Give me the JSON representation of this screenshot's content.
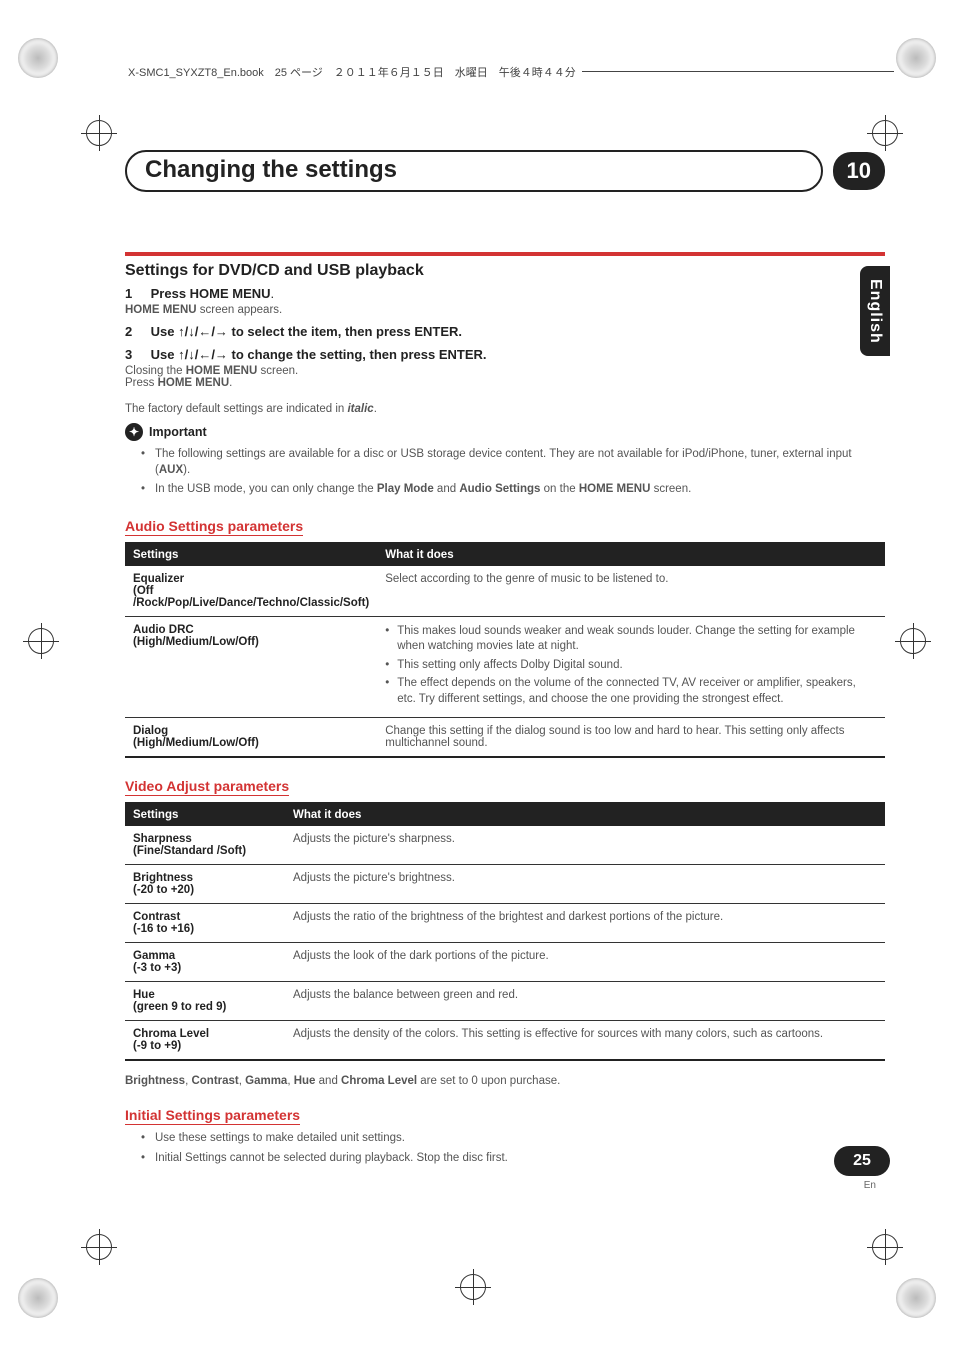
{
  "header_filename": "X-SMC1_SYXZT8_En.book　25 ページ　２０１１年６月１５日　水曜日　午後４時４４分",
  "chapter_title": "Changing the settings",
  "chapter_number": "10",
  "lang_tab": "English",
  "section_title": "Settings for DVD/CD and USB playback",
  "steps": [
    {
      "num": "1",
      "bold": "Press HOME MENU",
      "tail": ".",
      "subtext_prefix": "HOME MENU",
      "subtext_rest": " screen appears."
    },
    {
      "num": "2",
      "bold_prefix": "Use ",
      "arrows": "↑/↓/←/→",
      "bold_suffix": " to select the item, then press ENTER."
    },
    {
      "num": "3",
      "bold_prefix": "Use ",
      "arrows": "↑/↓/←/→",
      "bold_suffix": " to change the setting, then press ENTER.",
      "sub_multi": [
        "Closing the ",
        "HOME MENU",
        " screen.",
        "Press ",
        "HOME MENU",
        "."
      ]
    }
  ],
  "factory_note_pre": "The factory default settings are indicated in ",
  "factory_note_ital": "italic",
  "factory_note_post": ".",
  "important_label": "Important",
  "important_bullets": [
    {
      "parts": [
        "The following settings are available for a disc or USB storage device content. They are not available for iPod/iPhone, tuner, external input (",
        "AUX",
        ")."
      ]
    },
    {
      "parts": [
        "In the USB mode, you can only change the ",
        "Play Mode",
        " and ",
        "Audio Settings",
        " on the ",
        "HOME MENU",
        " screen."
      ]
    }
  ],
  "audio_heading": "Audio Settings parameters",
  "table_headers": {
    "col1": "Settings",
    "col2": "What it does"
  },
  "audio_rows": [
    {
      "name": "Equalizer",
      "sub": "(Off /Rock/Pop/Live/Dance/Techno/Classic/Soft)",
      "desc_plain": "Select according to the genre of music to be listened to."
    },
    {
      "name": "Audio DRC",
      "sub": "(High/Medium/Low/Off)",
      "desc_list": [
        "This makes loud sounds weaker and weak sounds louder. Change the setting for example when watching movies late at night.",
        "This setting only affects Dolby Digital sound.",
        "The effect depends on the volume of the connected TV, AV receiver or amplifier, speakers, etc. Try different settings, and choose the one providing the strongest effect."
      ]
    },
    {
      "name": "Dialog",
      "sub": "(High/Medium/Low/Off)",
      "desc_plain": "Change this setting if the dialog sound is too low and hard to hear. This setting only affects multichannel sound."
    }
  ],
  "video_heading": "Video Adjust parameters",
  "video_rows": [
    {
      "name": "Sharpness",
      "sub": "(Fine/Standard /Soft)",
      "desc": "Adjusts the picture's sharpness."
    },
    {
      "name": "Brightness",
      "sub": "(-20 to +20)",
      "desc": "Adjusts the picture's brightness."
    },
    {
      "name": "Contrast",
      "sub": "(-16 to +16)",
      "desc": "Adjusts the ratio of the brightness of the brightest and darkest portions of the picture."
    },
    {
      "name": "Gamma",
      "sub": "(-3 to +3)",
      "desc": "Adjusts the look of the dark portions of the picture."
    },
    {
      "name": "Hue",
      "sub": "(green 9 to red 9)",
      "desc": "Adjusts the balance between green and red."
    },
    {
      "name": "Chroma Level",
      "sub": "(-9 to +9)",
      "desc": "Adjusts the density of the colors. This setting is effective for sources with many colors, such as cartoons."
    }
  ],
  "video_footnote_bold": [
    "Brightness",
    "Contrast",
    "Gamma",
    "Hue",
    "Chroma Level"
  ],
  "video_footnote_text": " are set to 0 upon purchase.",
  "video_footnote_sep": ", ",
  "video_footnote_and": " and ",
  "initial_heading": "Initial Settings parameters",
  "initial_bullets": [
    "Use these settings to make detailed unit settings.",
    "Initial Settings cannot be selected during playback. Stop the disc first."
  ],
  "page_number": "25",
  "page_lang_small": "En"
}
